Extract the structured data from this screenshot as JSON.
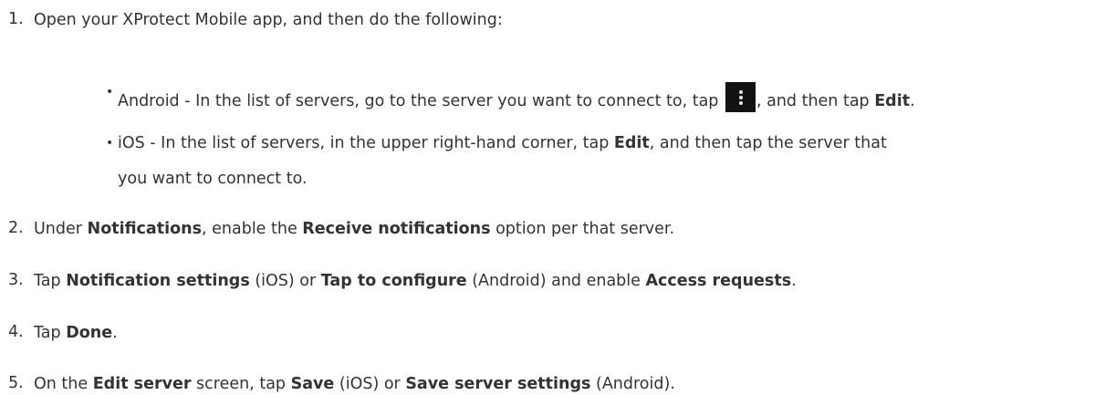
{
  "steps": [
    {
      "num": "1.",
      "text": "Open your XProtect Mobile app, and then do the following:"
    },
    {
      "num": "2.",
      "parts": [
        "Under ",
        "Notifications",
        ", enable the ",
        "Receive notifications",
        " option per that server."
      ]
    },
    {
      "num": "3.",
      "parts": [
        "Tap ",
        "Notification settings",
        " (iOS) or ",
        "Tap to configure",
        " (Android) and enable ",
        "Access requests",
        "."
      ]
    },
    {
      "num": "4.",
      "parts": [
        "Tap ",
        "Done",
        "."
      ]
    },
    {
      "num": "5.",
      "parts": [
        "On the ",
        "Edit server",
        " screen, tap ",
        "Save",
        " (iOS) or ",
        "Save server settings",
        " (Android)."
      ]
    }
  ],
  "substeps": [
    {
      "bullet": "•",
      "parts": [
        "Android - In the list of servers, go to the server you want to connect to, tap ",
        ", and then tap ",
        "Edit",
        "."
      ],
      "icon": "more-vertical-icon"
    },
    {
      "bullet": "•",
      "parts": [
        "iOS - In the list of servers, in the upper right-hand corner, tap ",
        "Edit",
        ", and then tap the server that"
      ],
      "continuation": "you want to connect to."
    }
  ]
}
